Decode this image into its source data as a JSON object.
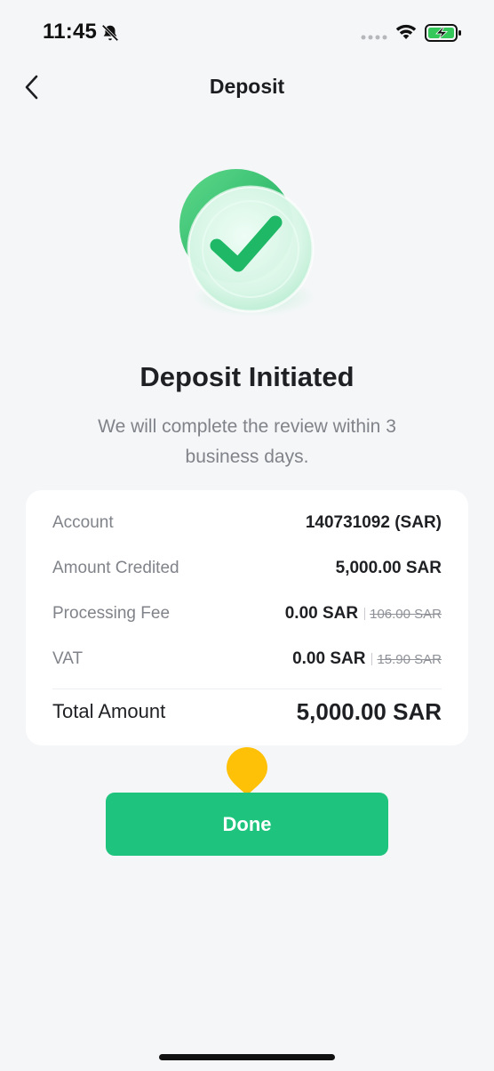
{
  "status_bar": {
    "time": "11:45",
    "icons": [
      "bell-slash-icon",
      "signal-dots-icon",
      "wifi-icon",
      "battery-charging-icon"
    ]
  },
  "nav": {
    "title": "Deposit",
    "back_icon": "chevron-left-icon"
  },
  "result": {
    "illustration": "success-check-icon",
    "title": "Deposit Initiated",
    "subtitle": "We will complete the review within 3 business days."
  },
  "details": {
    "account": {
      "label": "Account",
      "value": "140731092 (SAR)"
    },
    "amount_credited": {
      "label": "Amount Credited",
      "value": "5,000.00 SAR"
    },
    "processing_fee": {
      "label": "Processing Fee",
      "value": "0.00 SAR",
      "original": "106.00 SAR"
    },
    "vat": {
      "label": "VAT",
      "value": "0.00 SAR",
      "original": "15.90 SAR"
    },
    "total": {
      "label": "Total Amount",
      "value": "5,000.00 SAR"
    }
  },
  "actions": {
    "done_label": "Done"
  },
  "colors": {
    "accent": "#1ec47d",
    "background": "#f5f6f8",
    "marker": "#ffc107"
  }
}
